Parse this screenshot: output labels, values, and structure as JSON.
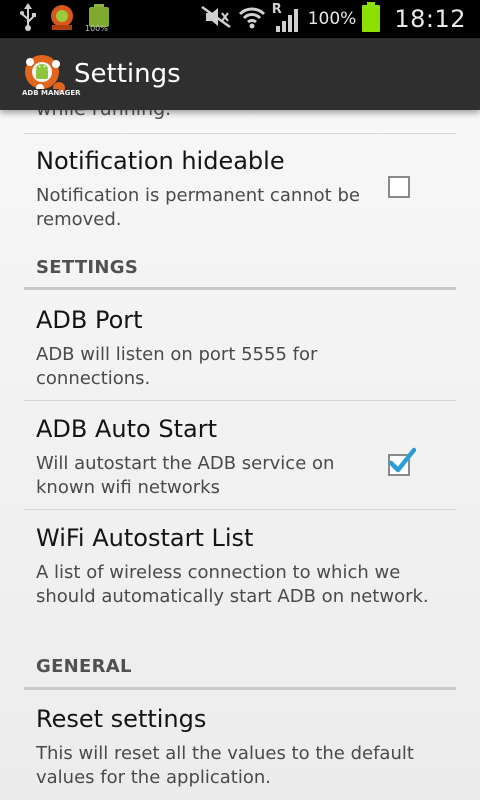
{
  "status_bar": {
    "left_icons": [
      "usb-icon",
      "adb-manager-notification-icon",
      "battery-full-notification-icon"
    ],
    "battery_notification_text": "100%",
    "right_icons": [
      "mute-icon",
      "wifi-icon",
      "signal-icon",
      "battery-icon"
    ],
    "roaming_indicator": "R",
    "battery_percent": "100%",
    "time": "18:12"
  },
  "action_bar": {
    "app_logo_text": "ADB MANAGER",
    "title": "Settings"
  },
  "prefs": {
    "cutoff_text": "while running.",
    "notification_hideable": {
      "title": "Notification hideable",
      "summary": "Notification is permanent cannot be removed.",
      "checked": false
    },
    "section_settings": "SETTINGS",
    "adb_port": {
      "title": "ADB Port",
      "summary": "ADB will listen on port 5555 for connections."
    },
    "adb_auto_start": {
      "title": "ADB Auto Start",
      "summary": "Will autostart the ADB service on known wifi networks",
      "checked": true
    },
    "wifi_autostart_list": {
      "title": "WiFi Autostart List",
      "summary": "A list of wireless connection to which we should automatically start ADB on network."
    },
    "section_general": "GENERAL",
    "reset_settings": {
      "title": "Reset settings",
      "summary": "This will reset all the values to the default values for the application."
    }
  },
  "colors": {
    "status_bar": "#000000",
    "action_bar": "#2f2f2f",
    "check_accent": "#2a9fd6",
    "battery_green": "#8ce000"
  }
}
